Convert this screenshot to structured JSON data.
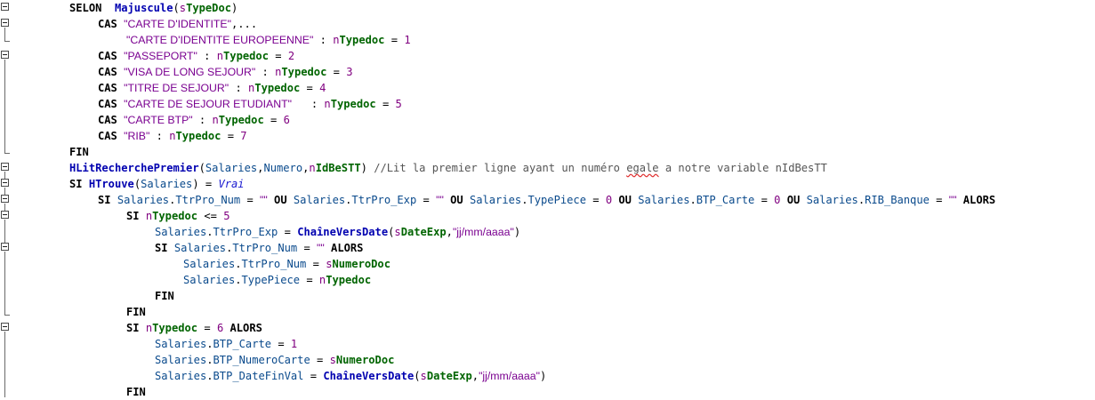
{
  "lines": [
    {
      "indent": 78,
      "parts": [
        {
          "t": "SELON",
          "c": "kw"
        },
        {
          "t": "  ",
          "c": "op"
        },
        {
          "t": "Majuscule",
          "c": "fn"
        },
        {
          "t": "(",
          "c": "op"
        },
        {
          "t": "s",
          "c": "pfx"
        },
        {
          "t": "TypeDoc",
          "c": "var"
        },
        {
          "t": ")",
          "c": "op"
        }
      ]
    },
    {
      "indent": 110,
      "parts": [
        {
          "t": "CAS ",
          "c": "kw"
        },
        {
          "t": "\"CARTE D'IDENTITE\"",
          "c": "str"
        },
        {
          "t": ",...",
          "c": "op"
        }
      ]
    },
    {
      "indent": 142,
      "parts": [
        {
          "t": "\"CARTE D'IDENTITE EUROPEENNE\"",
          "c": "str"
        },
        {
          "t": " : ",
          "c": "op"
        },
        {
          "t": "n",
          "c": "pfx"
        },
        {
          "t": "Typedoc",
          "c": "var"
        },
        {
          "t": " = ",
          "c": "op"
        },
        {
          "t": "1",
          "c": "num"
        }
      ]
    },
    {
      "indent": 110,
      "parts": [
        {
          "t": "CAS ",
          "c": "kw"
        },
        {
          "t": "\"PASSEPORT\"",
          "c": "str"
        },
        {
          "t": " : ",
          "c": "op"
        },
        {
          "t": "n",
          "c": "pfx"
        },
        {
          "t": "Typedoc",
          "c": "var"
        },
        {
          "t": " = ",
          "c": "op"
        },
        {
          "t": "2",
          "c": "num"
        }
      ]
    },
    {
      "indent": 110,
      "parts": [
        {
          "t": "CAS ",
          "c": "kw"
        },
        {
          "t": "\"VISA DE LONG SEJOUR\"",
          "c": "str"
        },
        {
          "t": " : ",
          "c": "op"
        },
        {
          "t": "n",
          "c": "pfx"
        },
        {
          "t": "Typedoc",
          "c": "var"
        },
        {
          "t": " = ",
          "c": "op"
        },
        {
          "t": "3",
          "c": "num"
        }
      ]
    },
    {
      "indent": 110,
      "parts": [
        {
          "t": "CAS ",
          "c": "kw"
        },
        {
          "t": "\"TITRE DE SEJOUR\"",
          "c": "str"
        },
        {
          "t": " : ",
          "c": "op"
        },
        {
          "t": "n",
          "c": "pfx"
        },
        {
          "t": "Typedoc",
          "c": "var"
        },
        {
          "t": " = ",
          "c": "op"
        },
        {
          "t": "4",
          "c": "num"
        }
      ]
    },
    {
      "indent": 110,
      "parts": [
        {
          "t": "CAS ",
          "c": "kw"
        },
        {
          "t": "\"CARTE DE SEJOUR ETUDIANT\"",
          "c": "str"
        },
        {
          "t": "   : ",
          "c": "op"
        },
        {
          "t": "n",
          "c": "pfx"
        },
        {
          "t": "Typedoc",
          "c": "var"
        },
        {
          "t": " = ",
          "c": "op"
        },
        {
          "t": "5",
          "c": "num"
        }
      ]
    },
    {
      "indent": 110,
      "parts": [
        {
          "t": "CAS ",
          "c": "kw"
        },
        {
          "t": "\"CARTE BTP\"",
          "c": "str"
        },
        {
          "t": " : ",
          "c": "op"
        },
        {
          "t": "n",
          "c": "pfx"
        },
        {
          "t": "Typedoc",
          "c": "var"
        },
        {
          "t": " = ",
          "c": "op"
        },
        {
          "t": "6",
          "c": "num"
        }
      ]
    },
    {
      "indent": 110,
      "parts": [
        {
          "t": "CAS ",
          "c": "kw"
        },
        {
          "t": "\"RIB\"",
          "c": "str"
        },
        {
          "t": " : ",
          "c": "op"
        },
        {
          "t": "n",
          "c": "pfx"
        },
        {
          "t": "Typedoc",
          "c": "var"
        },
        {
          "t": " = ",
          "c": "op"
        },
        {
          "t": "7",
          "c": "num"
        }
      ]
    },
    {
      "indent": 78,
      "parts": [
        {
          "t": "FIN",
          "c": "kw"
        }
      ]
    },
    {
      "indent": 78,
      "parts": [
        {
          "t": "HLitRecherchePremier",
          "c": "fn"
        },
        {
          "t": "(",
          "c": "op"
        },
        {
          "t": "Salaries",
          "c": "fld"
        },
        {
          "t": ",",
          "c": "op"
        },
        {
          "t": "Numero",
          "c": "fld"
        },
        {
          "t": ",",
          "c": "op"
        },
        {
          "t": "n",
          "c": "pfx"
        },
        {
          "t": "IdBeSTT",
          "c": "var"
        },
        {
          "t": ") ",
          "c": "op"
        },
        {
          "t": "//Lit la premier ligne ayant un numéro ",
          "c": "cmt"
        },
        {
          "t": "egale",
          "c": "cmt squig"
        },
        {
          "t": " a notre variable nIdBesTT",
          "c": "cmt"
        }
      ]
    },
    {
      "indent": 78,
      "parts": [
        {
          "t": "SI ",
          "c": "kw"
        },
        {
          "t": "HTrouve",
          "c": "fn"
        },
        {
          "t": "(",
          "c": "op"
        },
        {
          "t": "Salaries",
          "c": "fld"
        },
        {
          "t": ") = ",
          "c": "op"
        },
        {
          "t": "Vrai",
          "c": "bool"
        }
      ]
    },
    {
      "indent": 110,
      "parts": [
        {
          "t": "SI ",
          "c": "kw"
        },
        {
          "t": "Salaries",
          "c": "fld"
        },
        {
          "t": ".",
          "c": "op"
        },
        {
          "t": "TtrPro_Num",
          "c": "fld"
        },
        {
          "t": " = ",
          "c": "op"
        },
        {
          "t": "\"\"",
          "c": "str"
        },
        {
          "t": " OU ",
          "c": "kw"
        },
        {
          "t": "Salaries",
          "c": "fld"
        },
        {
          "t": ".",
          "c": "op"
        },
        {
          "t": "TtrPro_Exp",
          "c": "fld"
        },
        {
          "t": " = ",
          "c": "op"
        },
        {
          "t": "\"\"",
          "c": "str"
        },
        {
          "t": " OU ",
          "c": "kw"
        },
        {
          "t": "Salaries",
          "c": "fld"
        },
        {
          "t": ".",
          "c": "op"
        },
        {
          "t": "TypePiece",
          "c": "fld"
        },
        {
          "t": " = ",
          "c": "op"
        },
        {
          "t": "0",
          "c": "num"
        },
        {
          "t": " OU ",
          "c": "kw"
        },
        {
          "t": "Salaries",
          "c": "fld"
        },
        {
          "t": ".",
          "c": "op"
        },
        {
          "t": "BTP_Carte",
          "c": "fld"
        },
        {
          "t": " = ",
          "c": "op"
        },
        {
          "t": "0",
          "c": "num"
        },
        {
          "t": " OU ",
          "c": "kw"
        },
        {
          "t": "Salaries",
          "c": "fld"
        },
        {
          "t": ".",
          "c": "op"
        },
        {
          "t": "RIB_Banque",
          "c": "fld"
        },
        {
          "t": " = ",
          "c": "op"
        },
        {
          "t": "\"\"",
          "c": "str"
        },
        {
          "t": " ALORS",
          "c": "kw"
        }
      ]
    },
    {
      "indent": 142,
      "parts": [
        {
          "t": "SI ",
          "c": "kw"
        },
        {
          "t": "n",
          "c": "pfx"
        },
        {
          "t": "Typedoc",
          "c": "var"
        },
        {
          "t": " <= ",
          "c": "op"
        },
        {
          "t": "5",
          "c": "num"
        }
      ]
    },
    {
      "indent": 174,
      "parts": [
        {
          "t": "Salaries",
          "c": "fld"
        },
        {
          "t": ".",
          "c": "op"
        },
        {
          "t": "TtrPro_Exp",
          "c": "fld"
        },
        {
          "t": " = ",
          "c": "op"
        },
        {
          "t": "ChaîneVersDate",
          "c": "fn"
        },
        {
          "t": "(",
          "c": "op"
        },
        {
          "t": "s",
          "c": "pfx"
        },
        {
          "t": "DateExp",
          "c": "var"
        },
        {
          "t": ",",
          "c": "op"
        },
        {
          "t": "\"jj/mm/aaaa\"",
          "c": "str"
        },
        {
          "t": ")",
          "c": "op"
        }
      ]
    },
    {
      "indent": 174,
      "parts": [
        {
          "t": "SI ",
          "c": "kw"
        },
        {
          "t": "Salaries",
          "c": "fld"
        },
        {
          "t": ".",
          "c": "op"
        },
        {
          "t": "TtrPro_Num",
          "c": "fld"
        },
        {
          "t": " = ",
          "c": "op"
        },
        {
          "t": "\"\"",
          "c": "str"
        },
        {
          "t": " ALORS",
          "c": "kw"
        }
      ]
    },
    {
      "indent": 206,
      "parts": [
        {
          "t": "Salaries",
          "c": "fld"
        },
        {
          "t": ".",
          "c": "op"
        },
        {
          "t": "TtrPro_Num",
          "c": "fld"
        },
        {
          "t": " = ",
          "c": "op"
        },
        {
          "t": "s",
          "c": "pfx"
        },
        {
          "t": "NumeroDoc",
          "c": "var"
        }
      ]
    },
    {
      "indent": 206,
      "parts": [
        {
          "t": "Salaries",
          "c": "fld"
        },
        {
          "t": ".",
          "c": "op"
        },
        {
          "t": "TypePiece",
          "c": "fld"
        },
        {
          "t": " = ",
          "c": "op"
        },
        {
          "t": "n",
          "c": "pfx"
        },
        {
          "t": "Typedoc",
          "c": "var"
        }
      ]
    },
    {
      "indent": 174,
      "parts": [
        {
          "t": "FIN",
          "c": "kw"
        }
      ]
    },
    {
      "indent": 142,
      "parts": [
        {
          "t": "FIN",
          "c": "kw"
        }
      ]
    },
    {
      "indent": 142,
      "parts": [
        {
          "t": "SI ",
          "c": "kw"
        },
        {
          "t": "n",
          "c": "pfx"
        },
        {
          "t": "Typedoc",
          "c": "var"
        },
        {
          "t": " = ",
          "c": "op"
        },
        {
          "t": "6",
          "c": "num"
        },
        {
          "t": " ALORS",
          "c": "kw"
        }
      ]
    },
    {
      "indent": 174,
      "parts": [
        {
          "t": "Salaries",
          "c": "fld"
        },
        {
          "t": ".",
          "c": "op"
        },
        {
          "t": "BTP_Carte",
          "c": "fld"
        },
        {
          "t": " = ",
          "c": "op"
        },
        {
          "t": "1",
          "c": "num"
        }
      ]
    },
    {
      "indent": 174,
      "parts": [
        {
          "t": "Salaries",
          "c": "fld"
        },
        {
          "t": ".",
          "c": "op"
        },
        {
          "t": "BTP_NumeroCarte",
          "c": "fld"
        },
        {
          "t": " = ",
          "c": "op"
        },
        {
          "t": "s",
          "c": "pfx"
        },
        {
          "t": "NumeroDoc",
          "c": "var"
        }
      ]
    },
    {
      "indent": 174,
      "parts": [
        {
          "t": "Salaries",
          "c": "fld"
        },
        {
          "t": ".",
          "c": "op"
        },
        {
          "t": "BTP_DateFinVal",
          "c": "fld"
        },
        {
          "t": " = ",
          "c": "op"
        },
        {
          "t": "ChaîneVersDate",
          "c": "fn"
        },
        {
          "t": "(",
          "c": "op"
        },
        {
          "t": "s",
          "c": "pfx"
        },
        {
          "t": "DateExp",
          "c": "var"
        },
        {
          "t": ",",
          "c": "op"
        },
        {
          "t": "\"jj/mm/aaaa\"",
          "c": "str"
        },
        {
          "t": ")",
          "c": "op"
        }
      ]
    },
    {
      "indent": 142,
      "parts": [
        {
          "t": "FIN",
          "c": "kw"
        }
      ]
    }
  ]
}
